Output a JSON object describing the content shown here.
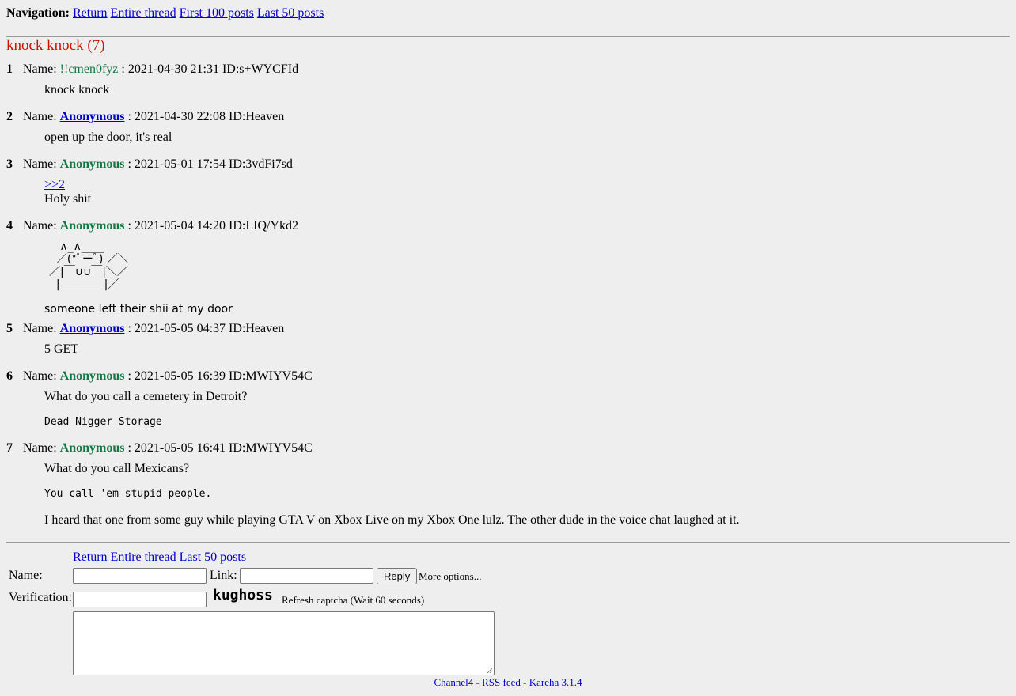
{
  "nav": {
    "label": "Navigation:",
    "links": [
      "Return",
      "Entire thread",
      "First 100 posts",
      "Last 50 posts"
    ]
  },
  "thread": {
    "title": "knock knock (7)"
  },
  "posts": [
    {
      "num": "1",
      "name_label": "Name:",
      "name": "!!cmen0fyz",
      "meta": " : 2021-04-30 21:31 ID:s+WYCFId",
      "lines": [
        "knock knock"
      ]
    },
    {
      "num": "2",
      "name_label": "Name:",
      "name": "Anonymous",
      "meta": " : 2021-04-30 22:08 ID:Heaven",
      "lines": [
        "open up the door, it's real"
      ]
    },
    {
      "num": "3",
      "name_label": "Name:",
      "name": "Anonymous",
      "meta": " : 2021-05-01 17:54 ID:3vdFi7sd",
      "quote": ">>2",
      "lines": [
        "Holy shit"
      ]
    },
    {
      "num": "4",
      "name_label": "Name:",
      "name": "Anonymous",
      "meta": " : 2021-05-04 14:20 ID:LIQ/Ykd2",
      "ascii_art": "   ∧_∧____\n  ／(*ﾟーﾟ) ／＼\n／|￣∪∪￣|＼／\n  |＿＿＿＿|／",
      "lines": [
        "someone left their shii at my door"
      ]
    },
    {
      "num": "5",
      "name_label": "Name:",
      "name": "Anonymous",
      "meta": " : 2021-05-05 04:37 ID:Heaven",
      "lines": [
        "5 GET"
      ]
    },
    {
      "num": "6",
      "name_label": "Name:",
      "name": "Anonymous",
      "meta": " : 2021-05-05 16:39 ID:MWIYV54C",
      "lines": [
        "What do you call a cemetery in Detroit?"
      ],
      "code": "Dead Nigger Storage"
    },
    {
      "num": "7",
      "name_label": "Name:",
      "name": "Anonymous",
      "meta": " : 2021-05-05 16:41 ID:MWIYV54C",
      "lines": [
        "What do you call Mexicans?"
      ],
      "code": "You call 'em stupid people.",
      "after": "I heard that one from some guy while playing GTA V on Xbox Live on my Xbox One lulz. The other dude in the voice chat laughed at it."
    }
  ],
  "reply_form": {
    "links": [
      "Return",
      "Entire thread",
      "Last 50 posts"
    ],
    "name_label": "Name:",
    "link_label": "Link:",
    "reply_button": "Reply",
    "more_options": "More options...",
    "verification_label": "Verification:",
    "captcha_text": "kughoss",
    "refresh_text": "Refresh captcha (Wait 60 seconds)"
  },
  "footer": {
    "links": [
      "Channel4",
      "RSS feed",
      "Kareha 3.1.4"
    ],
    "separator": " - "
  },
  "colors": {
    "background": "#eeeeee",
    "title": "#cc1105",
    "trip": "#117743",
    "link": "#0000cc"
  }
}
